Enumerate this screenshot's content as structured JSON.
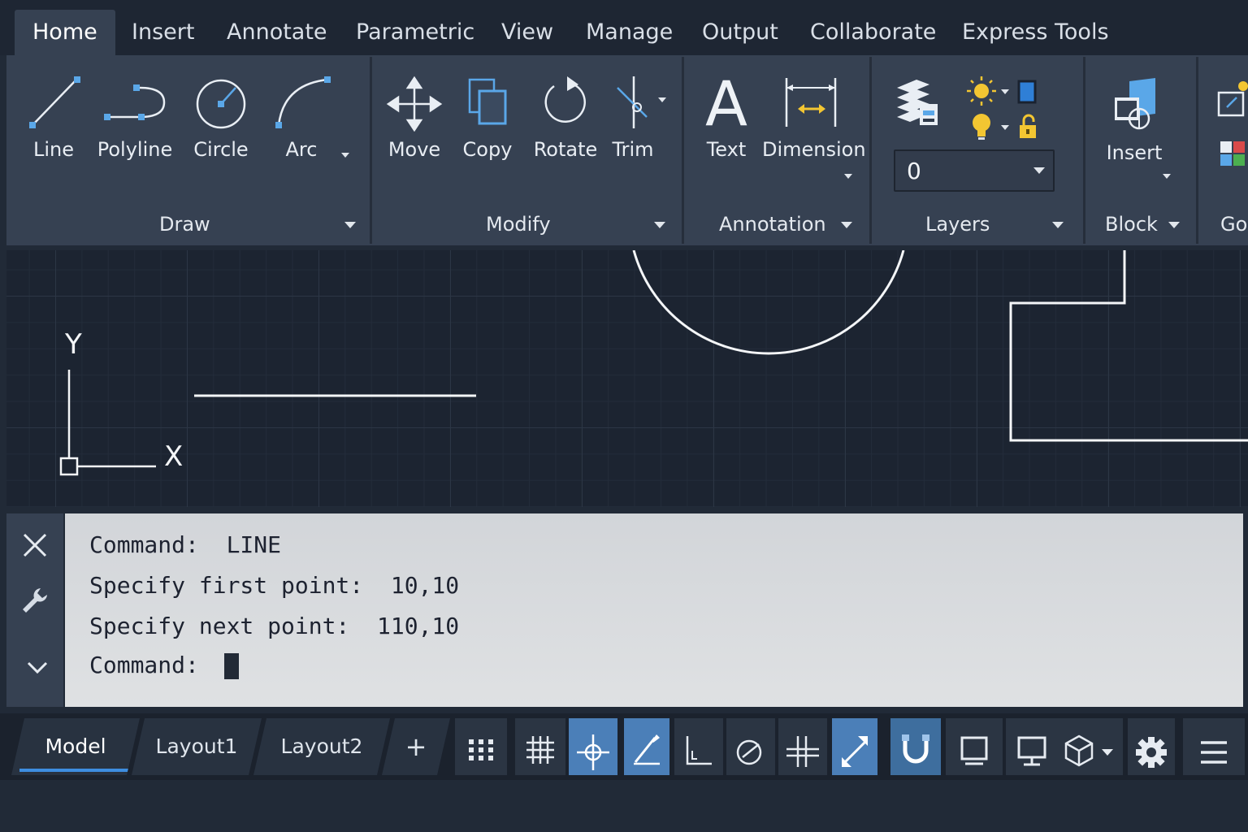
{
  "ribbon": {
    "tabs": [
      {
        "label": "Home",
        "active": true
      },
      {
        "label": "Insert"
      },
      {
        "label": "Annotate"
      },
      {
        "label": "Parametric"
      },
      {
        "label": "View"
      },
      {
        "label": "Manage"
      },
      {
        "label": "Output"
      },
      {
        "label": "Collaborate"
      },
      {
        "label": "Express Tools"
      }
    ],
    "panels": {
      "draw": {
        "title": "Draw",
        "tools": {
          "line": "Line",
          "polyline": "Polyline",
          "circle": "Circle",
          "arc": "Arc"
        }
      },
      "modify": {
        "title": "Modify",
        "tools": {
          "move": "Move",
          "copy": "Copy",
          "rotate": "Rotate",
          "trim": "Trim"
        }
      },
      "annotation": {
        "title": "Annotation",
        "tools": {
          "text": "Text",
          "dimension": "Dimension"
        }
      },
      "layers": {
        "title": "Layers",
        "current_layer": "0"
      },
      "block": {
        "title": "Block",
        "tools": {
          "insert": "Insert"
        }
      },
      "groups": {
        "title": "Go"
      }
    }
  },
  "drawing": {
    "ucs": {
      "x_label": "X",
      "y_label": "Y"
    }
  },
  "command_line": {
    "history": [
      "Command:  LINE",
      "Specify first point:  10,10",
      "Specify next point:  110,10",
      "Command: "
    ]
  },
  "status_bar": {
    "layout_tabs": [
      {
        "label": "Model",
        "active": true
      },
      {
        "label": "Layout1"
      },
      {
        "label": "Layout2"
      }
    ],
    "add_tab_label": "+",
    "toggles": {
      "snap": false,
      "grid": false,
      "object_snap": true,
      "polar_tracking": true,
      "ortho": false,
      "osnap_tracking": false,
      "dynamic_input": false,
      "lineweight": true,
      "selection_cycling": true
    }
  },
  "colors": {
    "accent": "#4b7fb8",
    "icon_blue": "#5aa7e8",
    "icon_yellow": "#f3c632"
  }
}
